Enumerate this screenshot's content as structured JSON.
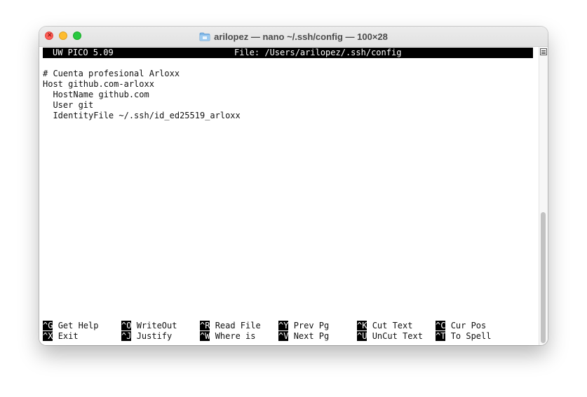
{
  "window": {
    "title": "arilopez — nano ~/.ssh/config — 100×28"
  },
  "editor": {
    "app_version": "UW PICO 5.09",
    "file_label": "File: /Users/arilopez/.ssh/config",
    "lines": [
      "# Cuenta profesional Arloxx",
      "Host github.com-arloxx",
      "  HostName github.com",
      "  User git",
      "  IdentityFile ~/.ssh/id_ed25519_arloxx"
    ]
  },
  "shortcuts": [
    {
      "key": "^G",
      "label": "Get Help"
    },
    {
      "key": "^O",
      "label": "WriteOut"
    },
    {
      "key": "^R",
      "label": "Read File"
    },
    {
      "key": "^Y",
      "label": "Prev Pg"
    },
    {
      "key": "^K",
      "label": "Cut Text"
    },
    {
      "key": "^C",
      "label": "Cur Pos"
    },
    {
      "key": "^X",
      "label": "Exit"
    },
    {
      "key": "^J",
      "label": "Justify"
    },
    {
      "key": "^W",
      "label": "Where is"
    },
    {
      "key": "^V",
      "label": "Next Pg"
    },
    {
      "key": "^U",
      "label": "UnCut Text"
    },
    {
      "key": "^T",
      "label": "To Spell"
    }
  ],
  "colors": {
    "close": "#ff5f57",
    "minimize": "#febc2e",
    "maximize": "#28c840",
    "inverse_bg": "#000000",
    "text": "#111111"
  },
  "icons": {
    "title_icon": "folder-icon",
    "scroll_icon": "scroll-handle-icon"
  }
}
